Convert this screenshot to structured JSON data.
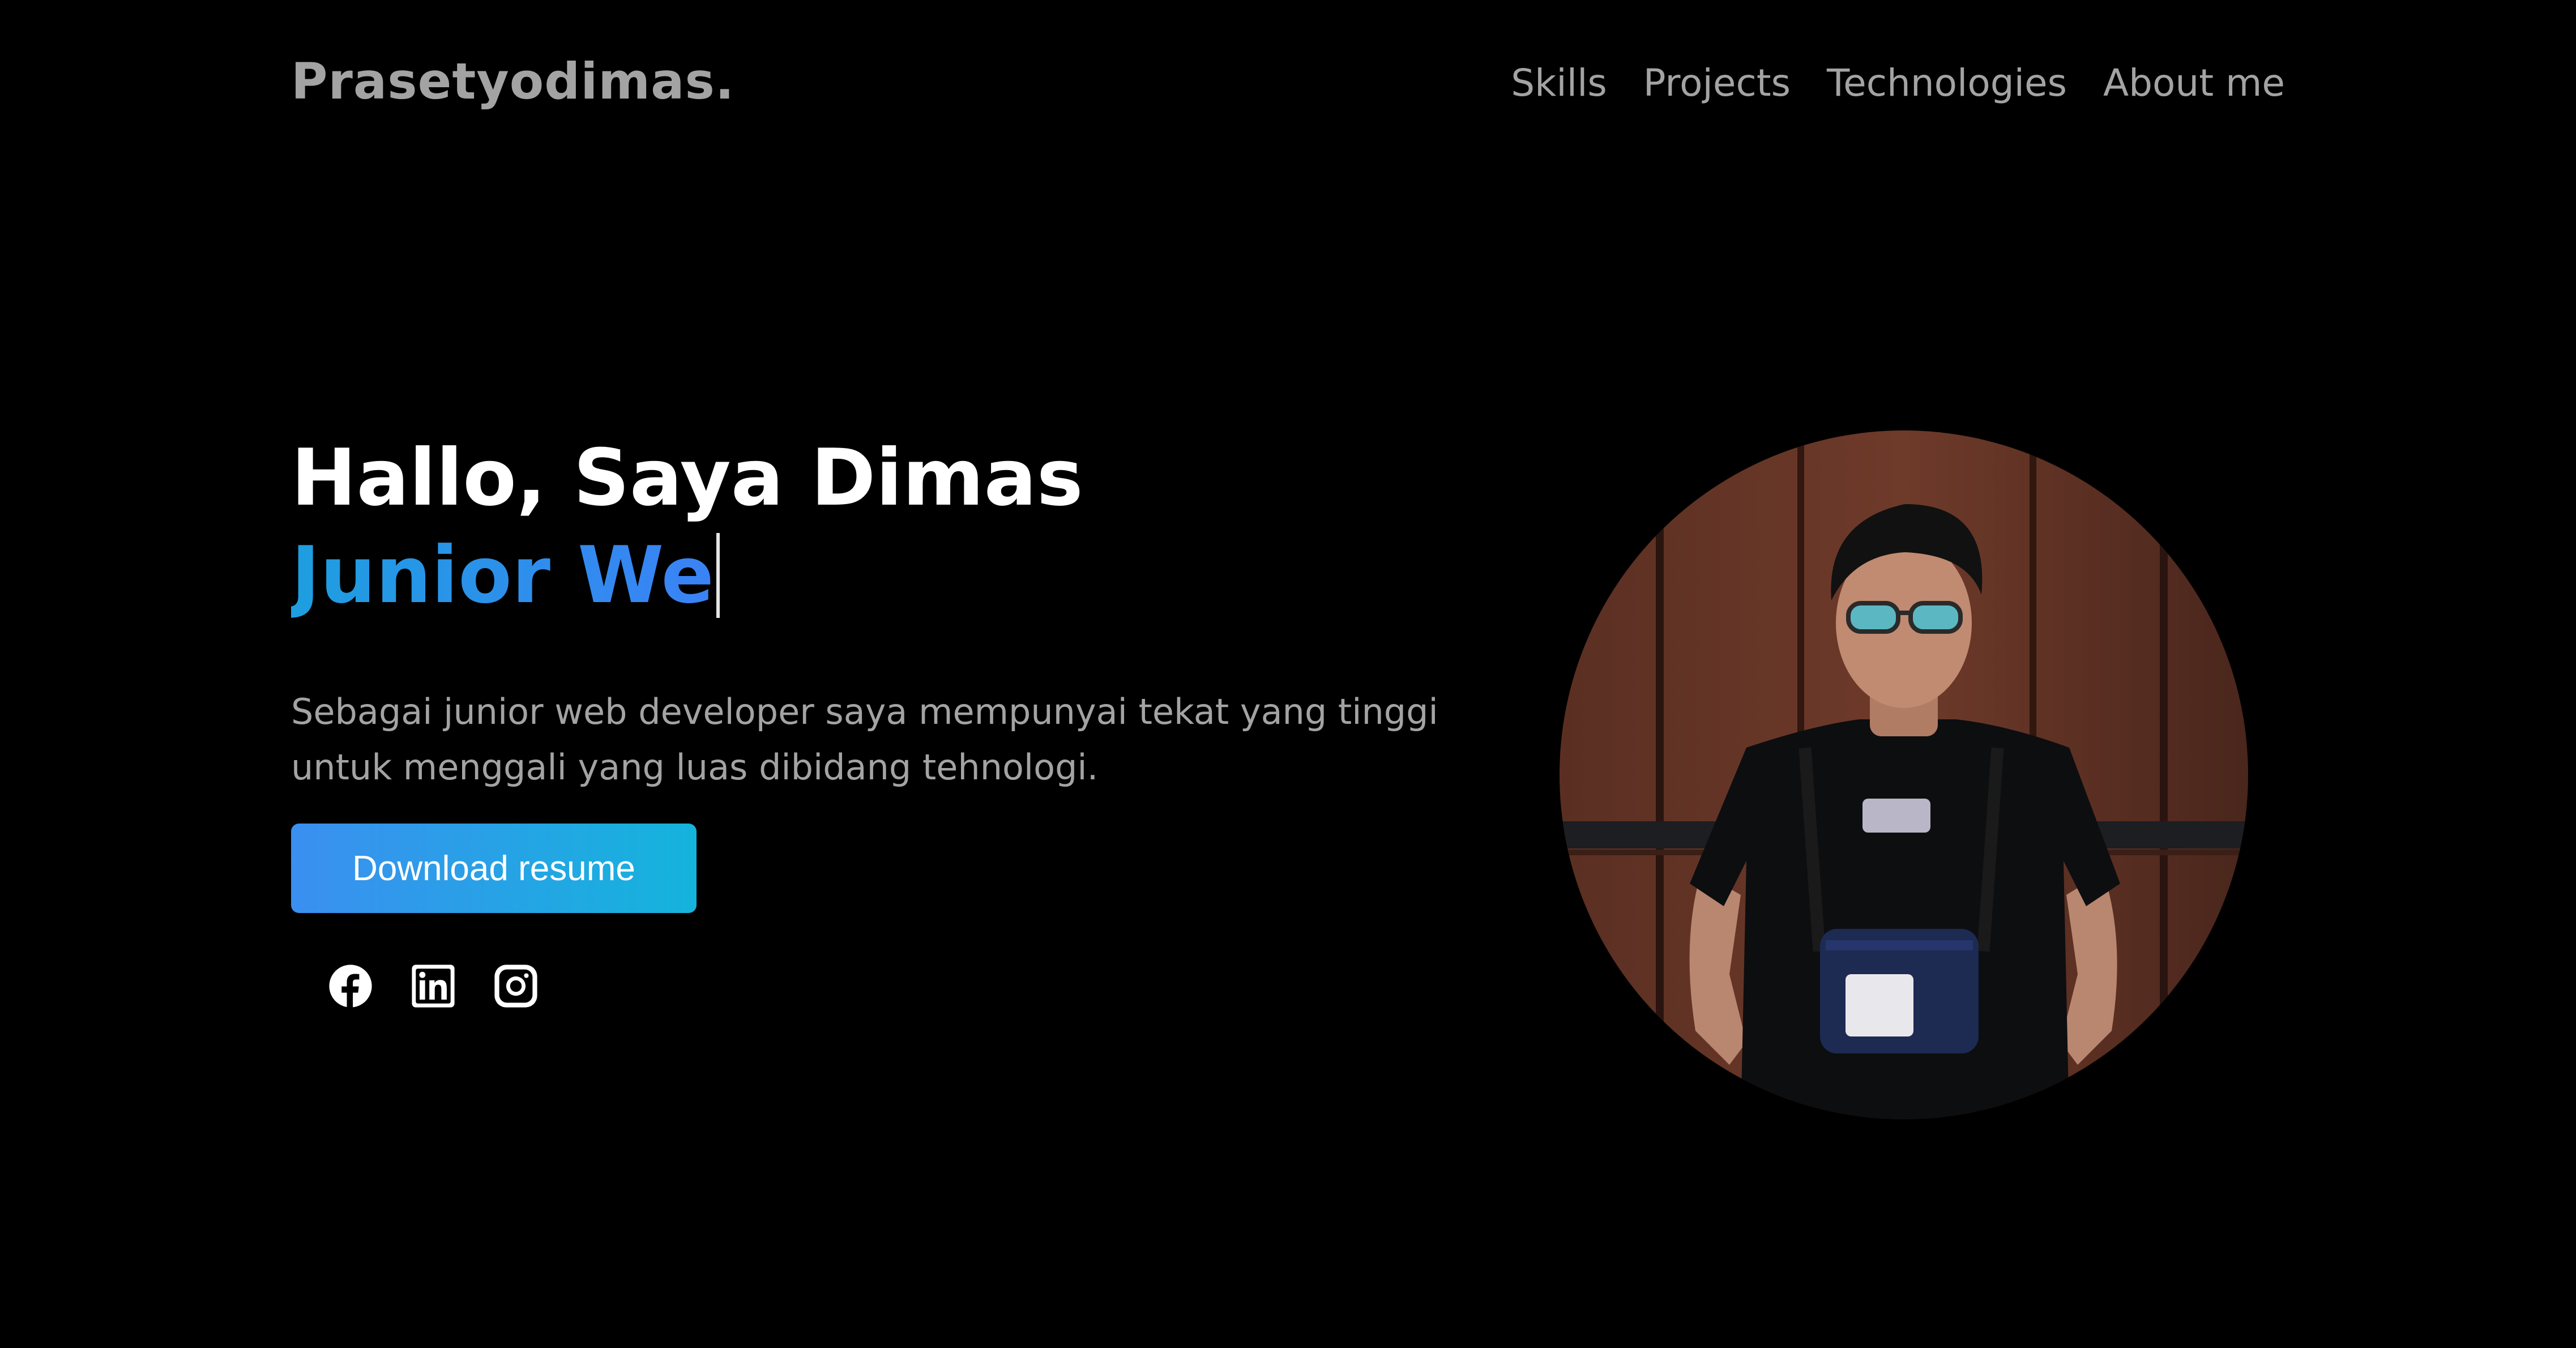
{
  "header": {
    "brand": "Prasetyodimas.",
    "nav": [
      {
        "label": "Skills"
      },
      {
        "label": "Projects"
      },
      {
        "label": "Technologies"
      },
      {
        "label": "About me"
      }
    ]
  },
  "hero": {
    "greeting": "Hallo, Saya Dimas",
    "role_typed": "Junior We",
    "description": "Sebagai junior web developer saya mempunyai tekat yang tinggi untuk menggali yang luas dibidang tehnologi.",
    "download_label": "Download resume"
  },
  "socials": [
    {
      "icon": "facebook-icon"
    },
    {
      "icon": "linkedin-icon"
    },
    {
      "icon": "instagram-icon"
    }
  ],
  "colors": {
    "background": "#000000",
    "accent_start": "#3b8ff0",
    "accent_end": "#14b4dc",
    "muted_text": "#a3a3a3"
  }
}
